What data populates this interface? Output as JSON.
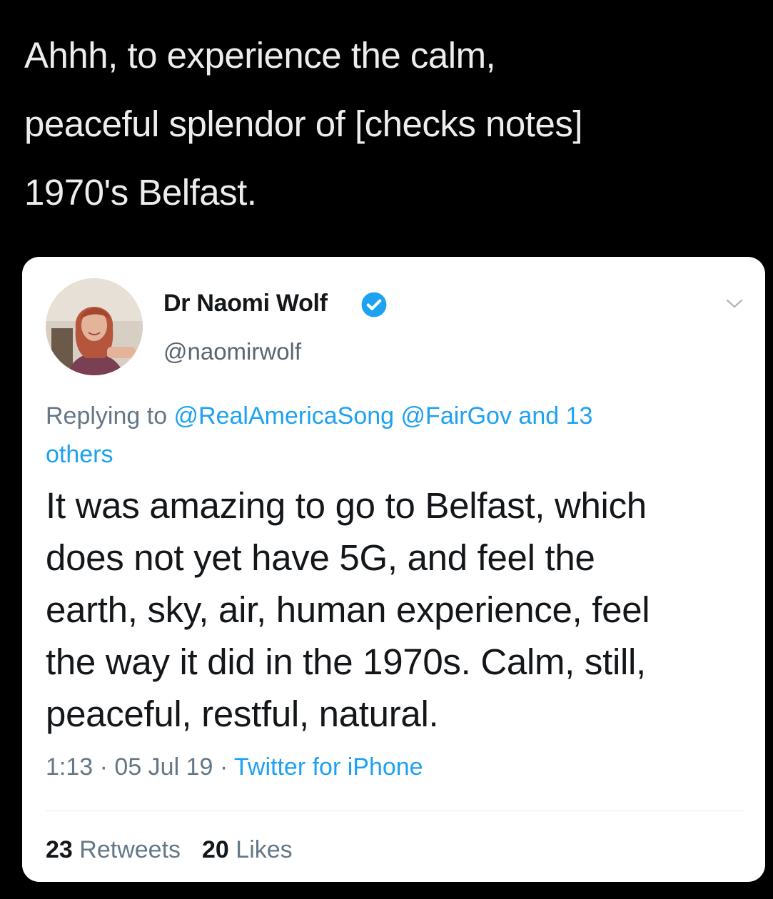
{
  "caption": {
    "lines": [
      "Ahhh, to experience the calm,",
      "peaceful splendor of [checks notes]",
      "1970's Belfast."
    ]
  },
  "tweet": {
    "display_name": "Dr Naomi Wolf",
    "handle": "@naomirwolf",
    "verified": true,
    "avatar_icon": "profile-photo",
    "reply": {
      "prefix": "Replying to ",
      "mention_1": "@RealAmericaSong",
      "mention_2": "@FairGov",
      "suffix_1": " and 13",
      "suffix_2": "others"
    },
    "body_lines": [
      "It was amazing to go to Belfast, which",
      "does not yet have 5G, and feel the",
      "earth, sky, air, human experience, feel",
      "the way it did in the 1970s. Calm, still,",
      "peaceful, restful, natural."
    ],
    "time": "1:13",
    "date": "05 Jul 19",
    "separator": " · ",
    "source": "Twitter for iPhone",
    "retweets": {
      "count": "23",
      "label": "Retweets"
    },
    "likes": {
      "count": "20",
      "label": "Likes"
    }
  },
  "colors": {
    "background": "#000000",
    "caption_text": "#ededed",
    "card": "#ffffff",
    "link_blue": "#1da1f2",
    "muted_gray": "#657786",
    "verified_blue": "#1da1f2"
  }
}
